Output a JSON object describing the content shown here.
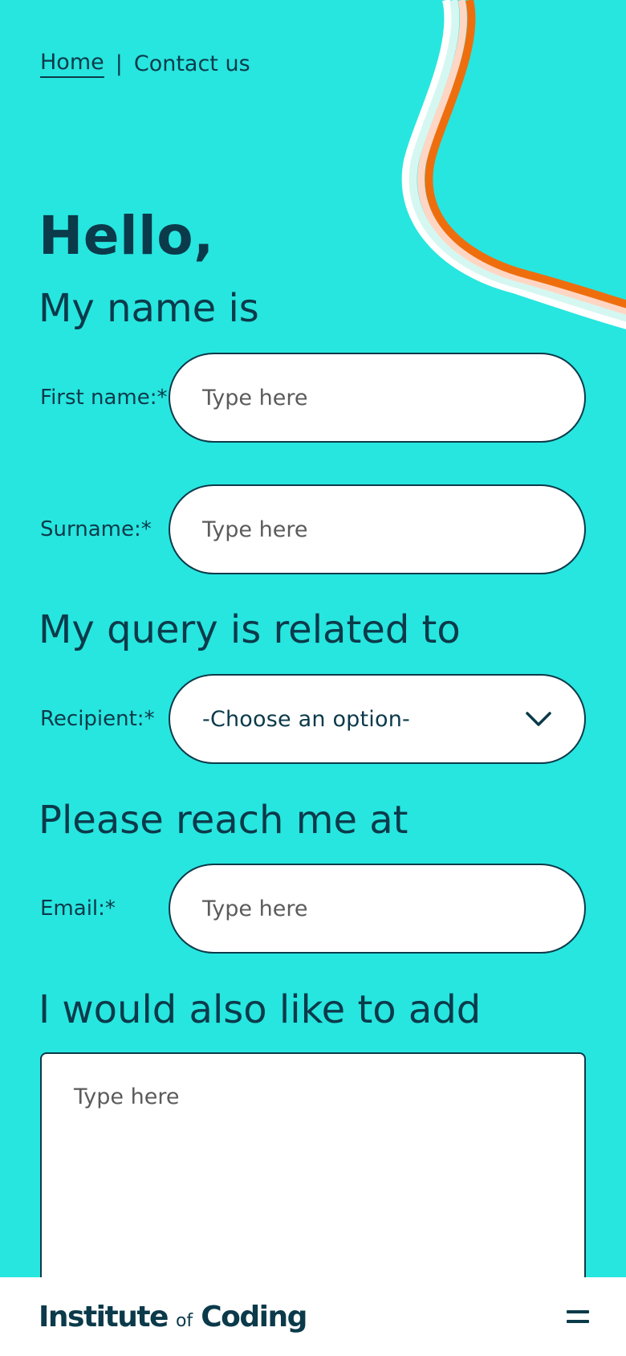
{
  "breadcrumb": {
    "home_label": "Home",
    "separator": "|",
    "current_label": "Contact us"
  },
  "greeting": "Hello,",
  "sections": {
    "name": "My name is",
    "query": "My query is related to",
    "reach": "Please reach me at",
    "add": "I would also like to add"
  },
  "fields": {
    "first_name": {
      "label": "First name:*",
      "placeholder": "Type here"
    },
    "surname": {
      "label": "Surname:*",
      "placeholder": "Type here"
    },
    "recipient": {
      "label": "Recipient:*",
      "selected": "-Choose an option-"
    },
    "email": {
      "label": "Email:*",
      "placeholder": "Type here"
    },
    "message": {
      "placeholder": "Type here"
    }
  },
  "footer": {
    "logo_part1": "Institute",
    "logo_part2": "of",
    "logo_part3": "Coding"
  },
  "icons": {
    "chevron": "chevron-down-icon",
    "menu": "hamburger-menu-icon"
  },
  "colors": {
    "background": "#27E6DF",
    "text": "#0B3A4A",
    "stripe_orange": "#EE6E0E",
    "stripe_peach": "#FFD6C4",
    "stripe_mint": "#D5F7F1",
    "stripe_white": "#FFFFFF"
  }
}
